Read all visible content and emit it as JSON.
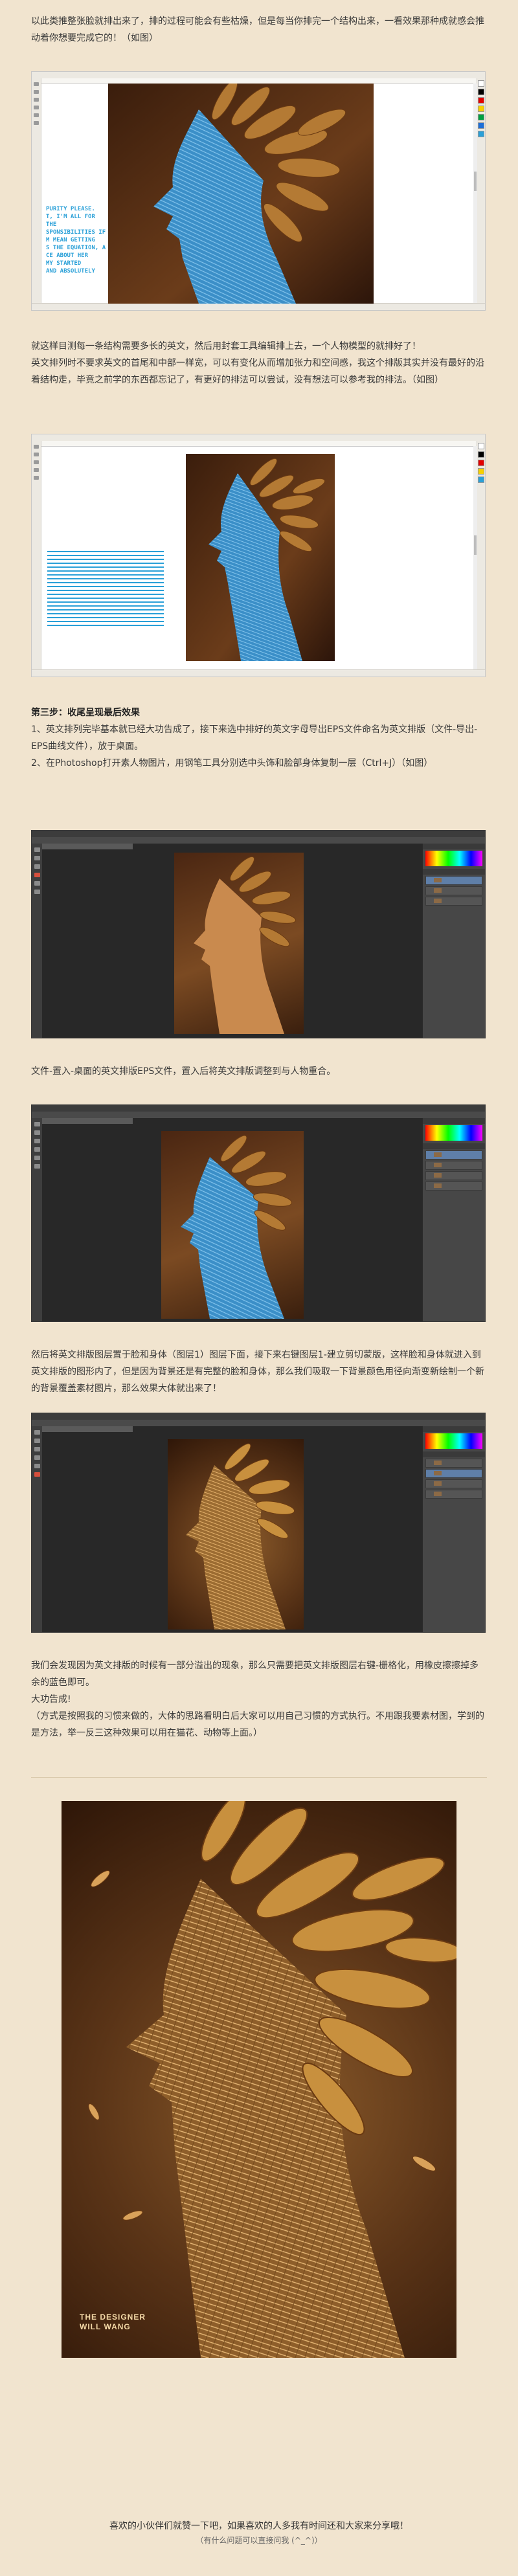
{
  "intro_text": "以此类推整张脸就排出来了，排的过程可能会有些枯燥，但是每当你排完一个结构出来，一看效果那种成就感会推动着你想要完成它的！（如图）",
  "step2_text": [
    "就这样目测每一条结构需要多长的英文，然后用封套工具编辑排上去，一个人物模型的就排好了！",
    "英文排列时不要求英文的首尾和中部一样宽，可以有变化从而增加张力和空间感，我这个排版其实并没有最好的沿着结构走，毕竟之前学的东西都忘记了，有更好的排法可以尝试，没有想法可以参考我的排法。（如图）"
  ],
  "step3": {
    "heading": "第三步：收尾呈现最后效果",
    "items": [
      "1、英文排列完毕基本就已经大功告成了，接下来选中排好的英文字母导出EPS文件命名为英文排版（文件-导出-EPS曲线文件），放于桌面。",
      "2、在Photoshop打开素人物图片，用钢笔工具分别选中头饰和脸部身体复制一层（Ctrl+J）（如图）"
    ]
  },
  "place_text": "文件-置入-桌面的英文排版EPS文件，置入后将英文排版调整到与人物重合。",
  "clip_text": "然后将英文排版图层置于脸和身体（图层1）图层下面，接下来右键图层1-建立剪切蒙版，这样脸和身体就进入到英文排版的图形内了，但是因为背景还是有完整的脸和身体，那么我们吸取一下背景颜色用径向渐变新绘制一个新的背景覆盖素材图片，那么效果大体就出来了！",
  "fix_text": [
    "我们会发现因为英文排版的时候有一部分溢出的现象，那么只需要把英文排版图层右键-栅格化，用橡皮擦擦掉多余的蓝色即可。",
    "大功告成!",
    "（方式是按照我的习惯来做的，大体的思路看明白后大家可以用自己习惯的方式执行。不用跟我要素材图，学到的是方法，举一反三这种效果可以用在猫花、动物等上面。）"
  ],
  "screenshot1_blue_text": "PURITY PLEASE.\nT, I'M ALL FOR\nTHE\nSPONSIBILITIES IF\nM MEAN GETTING\nS THE EQUATION, A\nCE ABOUT HER\nMY STARTED\nAND ABSOLUTELY",
  "final_credit": [
    "THE DESIGNER",
    "WILL WANG"
  ],
  "closing": {
    "line1": "喜欢的小伙伴们就赞一下吧，如果喜欢的人多我有时间还和大家来分享哦！",
    "line2": "（有什么问题可以直接问我 (^_^)）"
  },
  "colors": {
    "page_bg": "#f1e4cf",
    "coreldraw_text_blue": "#2aa0d8",
    "ps_workspace": "#535353",
    "feather_gold": "#c8903e"
  },
  "icons": {
    "ps_tools": [
      "move-icon",
      "marquee-icon",
      "lasso-icon",
      "pen-icon",
      "brush-icon",
      "eraser-icon"
    ]
  }
}
